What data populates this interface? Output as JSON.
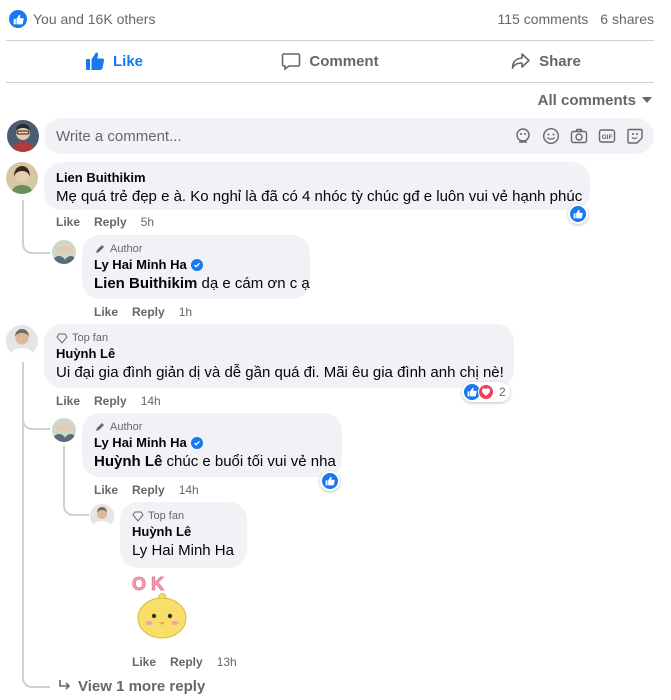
{
  "reactions": {
    "summary": "You and 16K others",
    "comments_count": "115 comments",
    "shares_count": "6 shares"
  },
  "actions": {
    "like": "Like",
    "comment": "Comment",
    "share": "Share"
  },
  "filter": {
    "label": "All comments"
  },
  "composer": {
    "placeholder": "Write a comment..."
  },
  "comments": [
    {
      "name": "Lien Buithikim",
      "text": "Mẹ quá trẻ đẹp e à. Ko nghỉ là đã có 4 nhóc tỳ chúc gđ e luôn vui vẻ hạnh phúc",
      "like": "Like",
      "reply": "Reply",
      "time": "5h",
      "reply_item": {
        "badge": "Author",
        "name": "Ly Hai Minh Ha",
        "mention": "Lien Buithikim",
        "text": "dạ e cám ơn c ạ",
        "like": "Like",
        "reply": "Reply",
        "time": "1h"
      }
    },
    {
      "badge": "Top fan",
      "name": "Huỳnh Lê",
      "text": "Ui đại gia đình giản dị và dễ gần quá đi. Mãi êu gia đình anh chị nè!",
      "like": "Like",
      "reply": "Reply",
      "time": "14h",
      "reaction_count": "2",
      "reply_item": {
        "badge": "Author",
        "name": "Ly Hai Minh Ha",
        "mention": "Huỳnh Lê",
        "text": "chúc e buổi tối vui vẻ nha",
        "like": "Like",
        "reply": "Reply",
        "time": "14h"
      },
      "nested_reply": {
        "badge": "Top fan",
        "name": "Huỳnh Lê",
        "mention": "Ly Hai Minh Ha",
        "sticker_text": "O K",
        "like": "Like",
        "reply": "Reply",
        "time": "13h"
      }
    }
  ],
  "view_more": "View 1 more reply",
  "colors": {
    "accent": "#1877f2",
    "muted": "#65676b",
    "bubble": "#f0f2f5",
    "love": "#f33e58"
  }
}
